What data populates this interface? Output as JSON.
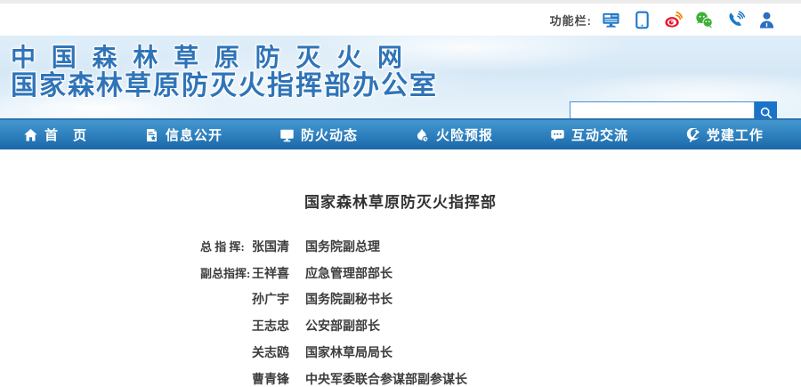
{
  "colors": {
    "nav_blue_top": "#4697ce",
    "nav_blue_bottom": "#1b67a8",
    "logo_blue": "#2f74b8",
    "search_button_blue": "#1a73c8",
    "banner_light_blue": "#d6e8f6",
    "weibo_red": "#e6162d",
    "wechat_green": "#3eb135",
    "icon_blue": "#1e78c8",
    "text_dark": "#3d3d3d"
  },
  "topbar": {
    "label": "功能栏:",
    "icons": [
      {
        "name": "desktop-icon"
      },
      {
        "name": "mobile-icon"
      },
      {
        "name": "weibo-icon"
      },
      {
        "name": "wechat-icon"
      },
      {
        "name": "phone-icon"
      },
      {
        "name": "user-icon"
      }
    ]
  },
  "header": {
    "title_line1": "中 国 森 林 草 原 防 灭 火 网",
    "title_line2": "国家森林草原防灭火指挥部办公室",
    "search": {
      "value": "",
      "placeholder": ""
    }
  },
  "nav": {
    "items": [
      {
        "label": "首　页",
        "icon": "home-icon"
      },
      {
        "label": "信息公开",
        "icon": "document-icon"
      },
      {
        "label": "防火动态",
        "icon": "monitor-icon"
      },
      {
        "label": "火险预报",
        "icon": "fire-icon"
      },
      {
        "label": "互动交流",
        "icon": "chat-icon"
      },
      {
        "label": "党建工作",
        "icon": "party-icon"
      }
    ]
  },
  "content": {
    "title": "国家森林草原防灭火指挥部",
    "rows": [
      {
        "label": "总 指 挥:",
        "name": "张国清",
        "title": "国务院副总理"
      },
      {
        "label": "副总指挥:",
        "name": "王祥喜",
        "title": "应急管理部部长"
      },
      {
        "label": "",
        "name": "孙广宇",
        "title": "国务院副秘书长"
      },
      {
        "label": "",
        "name": "王志忠",
        "title": "公安部副部长"
      },
      {
        "label": "",
        "name": "关志鸥",
        "title": "国家林草局局长"
      },
      {
        "label": "",
        "name": "曹青锋",
        "title": "中央军委联合参谋部副参谋长"
      }
    ]
  }
}
